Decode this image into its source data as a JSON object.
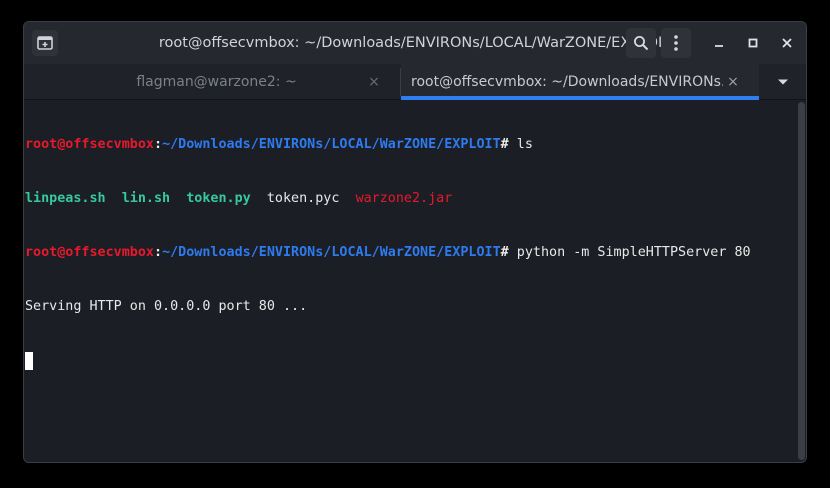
{
  "window": {
    "title": "root@offsecvmbox: ~/Downloads/ENVIRONs/LOCAL/WarZONE/EXPLOIT"
  },
  "icons": {
    "new_tab": "new-tab-icon",
    "search": "search-icon",
    "menu": "kebab-menu-icon",
    "minimize": "minimize-icon",
    "maximize": "maximize-icon",
    "close": "close-icon",
    "tab_close": "close-icon",
    "tab_menu": "chevron-down-icon"
  },
  "tabs": [
    {
      "label": "flagman@warzone2: ~",
      "close": "×",
      "active": false
    },
    {
      "label": "root@offsecvmbox: ~/Downloads/ENVIRONs…",
      "close": "×",
      "active": true
    }
  ],
  "terminal": {
    "lines": [
      {
        "user_host": "root@offsecvmbox",
        "sep": ":",
        "path": "~/Downloads/ENVIRONs/LOCAL/WarZONE/EXPLOIT",
        "prompt": "#",
        "command": " ls"
      },
      {
        "files": [
          {
            "name": "linpeas.sh",
            "kind": "exec"
          },
          {
            "name": "lin.sh",
            "kind": "exec"
          },
          {
            "name": "token.py",
            "kind": "exec"
          },
          {
            "name": "token.pyc",
            "kind": "plain"
          },
          {
            "name": "warzone2.jar",
            "kind": "archive"
          }
        ]
      },
      {
        "user_host": "root@offsecvmbox",
        "sep": ":",
        "path": "~/Downloads/ENVIRONs/LOCAL/WarZONE/EXPLOIT",
        "prompt": "#",
        "command": " python -m SimpleHTTPServer 80"
      },
      {
        "output": "Serving HTTP on 0.0.0.0 port 80 ..."
      }
    ]
  },
  "colors": {
    "prompt_user": "#e8192c",
    "prompt_path": "#2e7bf0",
    "exec_file": "#37c99a",
    "archive_file": "#e8192c",
    "tab_indicator": "#2f7df0",
    "background": "#1b1e25"
  }
}
